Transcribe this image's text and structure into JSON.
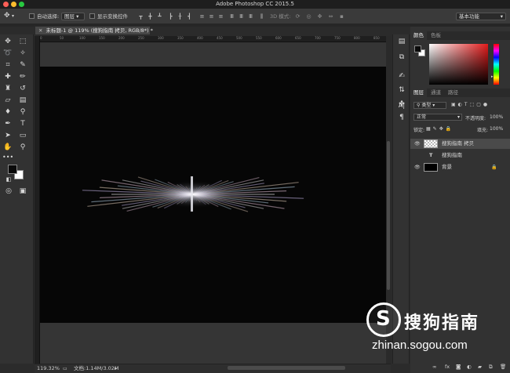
{
  "window": {
    "title": "Adobe Photoshop CC 2015.5"
  },
  "options_bar": {
    "auto_select_label": "自动选择:",
    "auto_select_value": "图层",
    "show_transform_label": "显示变换控件",
    "mode_3d_label": "3D 模式:",
    "workspace_value": "基本功能"
  },
  "document": {
    "tab_label": "未标题-1 @ 119% (搜狗指南 拷贝, RGB/8*) *",
    "zoom": "119.32%",
    "doc_size": "文档:1.14M/3.02M",
    "ruler_ticks": [
      "0",
      "50",
      "100",
      "150",
      "200",
      "250",
      "300",
      "350",
      "400",
      "450",
      "500",
      "550",
      "600",
      "650",
      "700",
      "750",
      "800",
      "850"
    ]
  },
  "color_panel": {
    "tabs": [
      "颜色",
      "色板"
    ],
    "accent": "#e31b1b"
  },
  "layers_panel": {
    "tabs": [
      "图层",
      "通道",
      "路径"
    ],
    "filter_kind": "类型",
    "blend_mode": "正常",
    "opacity_label": "不透明度:",
    "opacity_value": "100%",
    "lock_label": "锁定:",
    "fill_label": "填充:",
    "fill_value": "100%",
    "layers": [
      {
        "name": "搜狗指南 拷贝",
        "type": "raster",
        "selected": true
      },
      {
        "name": "搜狗指南",
        "type": "text",
        "selected": false
      },
      {
        "name": "背景",
        "type": "background",
        "selected": false
      }
    ],
    "bottom_icons": [
      "link-icon",
      "fx-icon",
      "mask-icon",
      "adjustment-icon",
      "folder-icon",
      "new-layer-icon",
      "trash-icon"
    ]
  },
  "watermark": {
    "text": "搜狗指南",
    "url": "zhinan.sogou.com"
  }
}
